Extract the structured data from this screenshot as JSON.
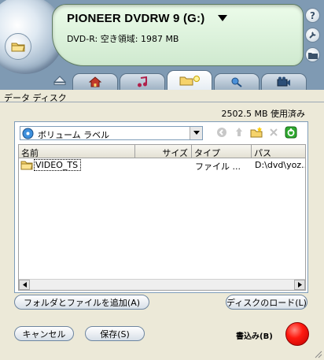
{
  "drive": {
    "title": "PIONEER DVDRW 9 (G:)",
    "info": "DVD-R: 空き領域: 1987 MB"
  },
  "side_buttons": [
    "?"
  ],
  "tabs": [
    {
      "name": "home",
      "icon": "house-icon"
    },
    {
      "name": "music",
      "icon": "music-note-icon"
    },
    {
      "name": "data",
      "icon": "data-disc-icon",
      "active": true
    },
    {
      "name": "tools",
      "icon": "tools-icon"
    },
    {
      "name": "video",
      "icon": "video-icon"
    }
  ],
  "section": {
    "label": "データ ディスク",
    "usage": "2502.5 MB 使用済み"
  },
  "browser": {
    "volume_label": "ボリューム ラベル",
    "columns": [
      "名前",
      "サイズ",
      "タイプ",
      "パス"
    ],
    "rows": [
      {
        "name": "VIDEO_TS",
        "size": "",
        "type": "ファイル ...",
        "path": "D:\\dvd\\yoz..."
      }
    ]
  },
  "buttons": {
    "add": "フォルダとファイルを追加(A)",
    "load": "ディスクのロード(L)",
    "cancel": "キャンセル",
    "save": "保存(S)",
    "burn": "書込み(B)"
  },
  "colors": {
    "skin": "#7f9ab3",
    "lcd": "#e4f7e3",
    "burn": "#ff1a10"
  }
}
